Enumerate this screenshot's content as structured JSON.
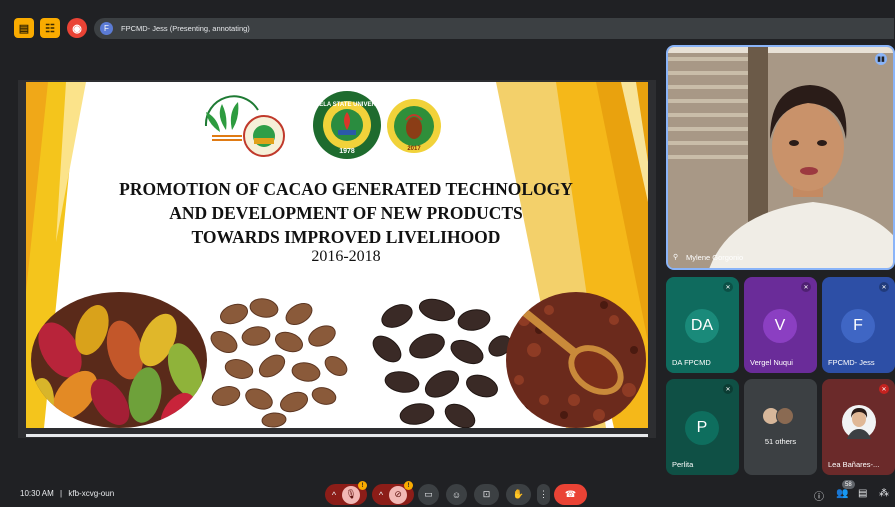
{
  "meeting_bar": {
    "presenter_initial": "F",
    "presenter_status": "FPCMD- Jess (Presenting, annotating)"
  },
  "slide": {
    "title_lines": [
      "PROMOTION OF CACAO GENERATED TECHNOLOGY",
      "AND DEVELOPMENT OF NEW PRODUCTS",
      "TOWARDS IMPROVED LIVELIHOOD"
    ],
    "years": "2016-2018",
    "logos": {
      "agriculture": "BUREAU OF AGRICULTURAL RESEARCH",
      "university": "ISABELA STATE UNIVERSITY",
      "university_year": "1978",
      "cacao_center": "ISU Cacao Development Center",
      "cacao_center_year": "2017"
    }
  },
  "speaker": {
    "name": "Mylene Gorgonio"
  },
  "participants": [
    {
      "initials": "DA",
      "name": "DA FPCMD",
      "color": "#0f6b5e"
    },
    {
      "initials": "V",
      "name": "Vergel Nuqui",
      "color": "#7b2ca9"
    },
    {
      "initials": "F",
      "name": "FPCMD- Jess",
      "color": "#2d4fa6"
    },
    {
      "initials": "P",
      "name": "Perlita",
      "color": "#0f5d4f"
    },
    {
      "initials": "",
      "name": "51 others",
      "color": "#3c4043"
    },
    {
      "initials": "",
      "name": "Lea Bañares-...",
      "color": "#6b2a2a"
    }
  ],
  "bottom_bar": {
    "time": "10:30 AM",
    "separator": "|",
    "meeting_code": "kfb-xcvg-oun",
    "mic_badge": "!",
    "cam_badge": "!",
    "people_count": "58"
  },
  "colors": {
    "accent_yellow": "#f9ab00",
    "end_call_red": "#ea4335",
    "bar_dark": "#3c4043"
  },
  "icons": {
    "top": [
      "notes-icon",
      "activities-icon",
      "record-icon"
    ],
    "controls": [
      "mic-off-icon",
      "camera-off-icon",
      "captions-icon",
      "emoji-icon",
      "present-icon",
      "raise-hand-icon",
      "more-options-icon",
      "end-call-icon"
    ],
    "right": [
      "info-icon",
      "people-icon",
      "chat-icon",
      "activities-grid-icon"
    ]
  }
}
